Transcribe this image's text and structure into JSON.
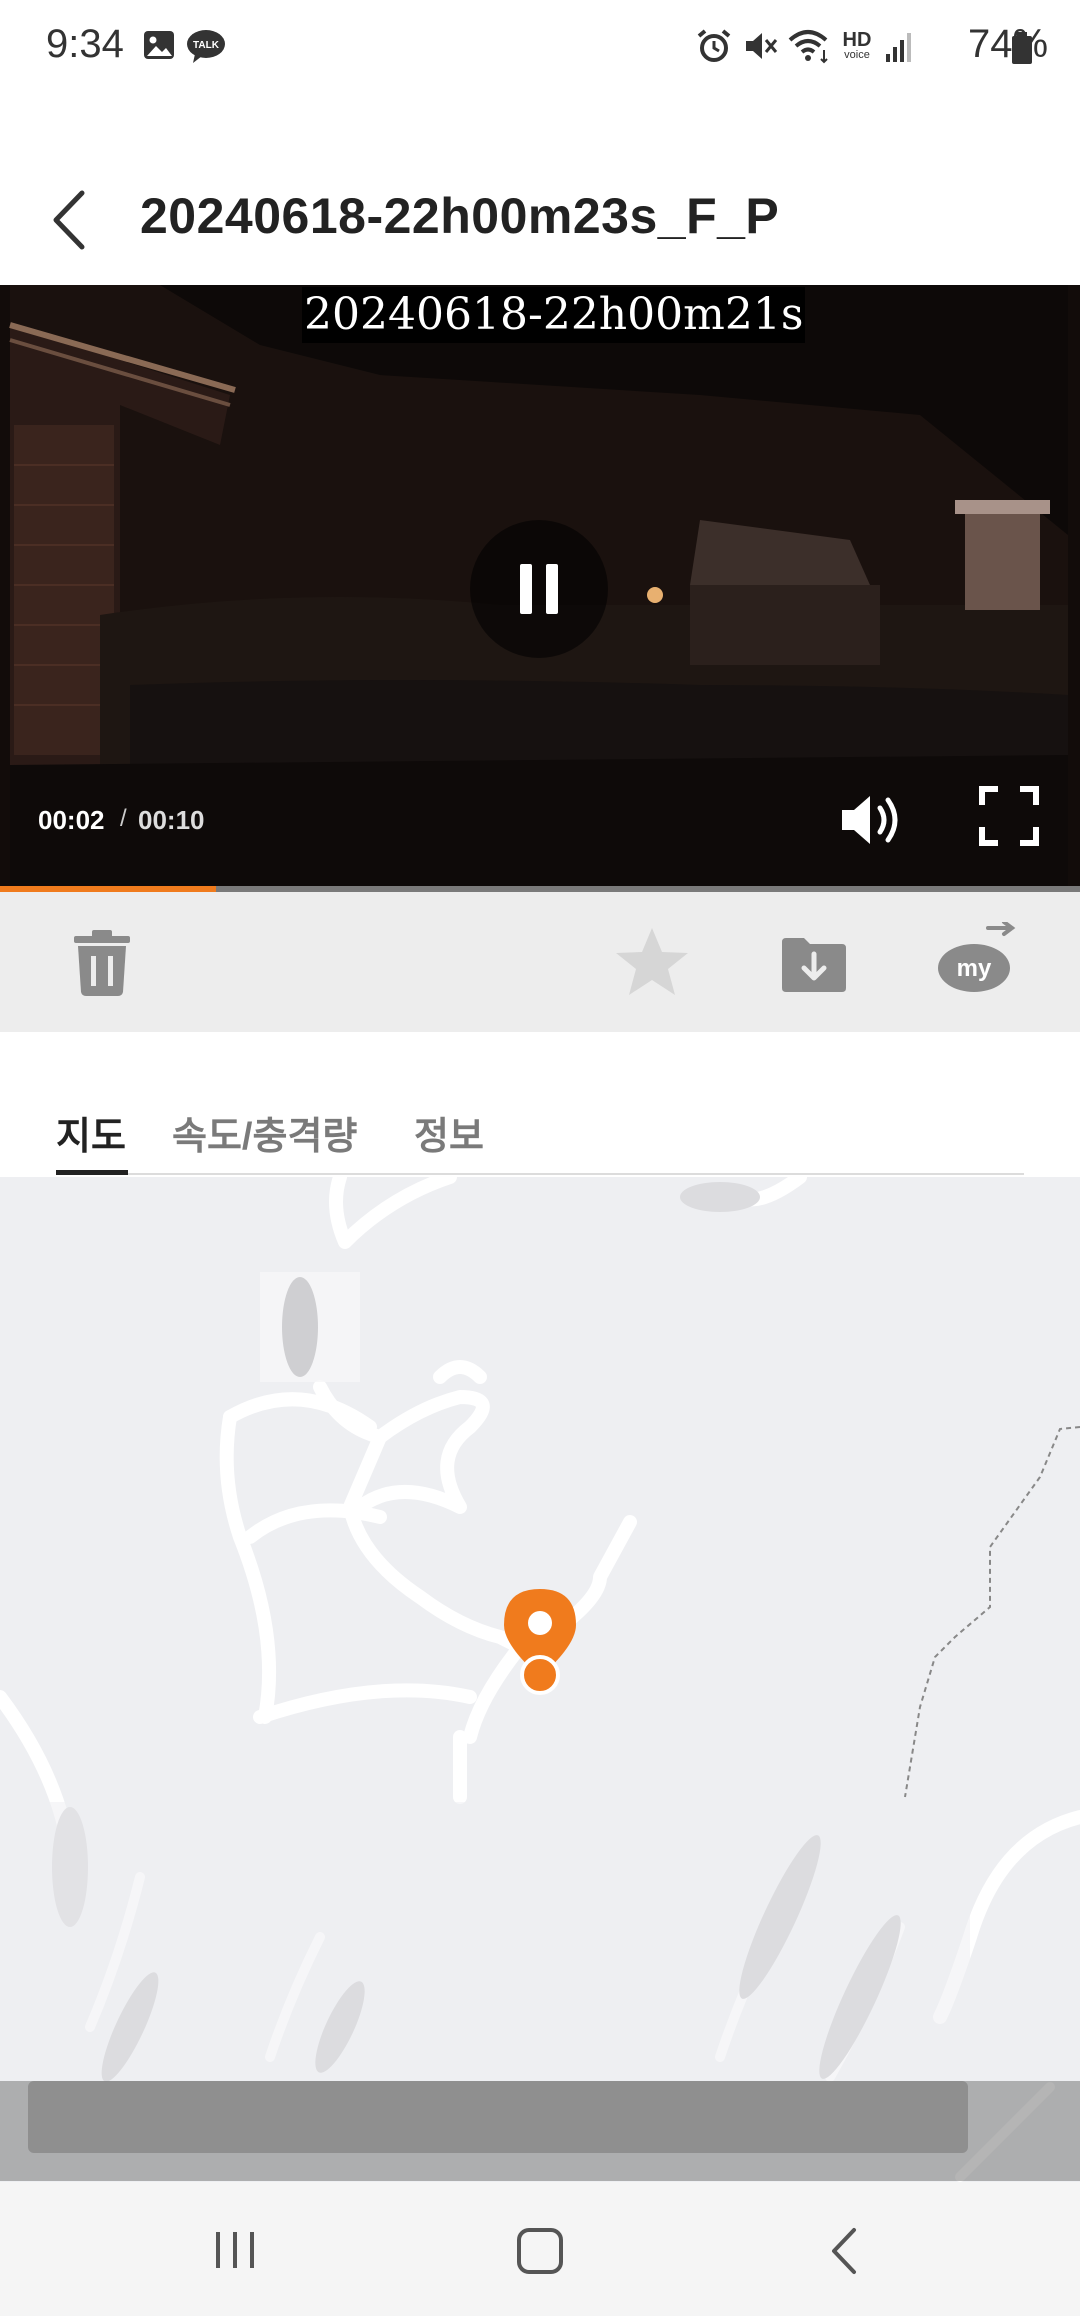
{
  "status_bar": {
    "time": "9:34",
    "battery": "74%",
    "network_badge": "HD",
    "network_badge_sub": "voice",
    "icons": [
      "gallery-icon",
      "talk-icon",
      "alarm-icon",
      "mute-icon",
      "wifi-icon",
      "hd-voice-icon",
      "signal-icon",
      "battery-icon"
    ],
    "talk_label": "TALK"
  },
  "header": {
    "title": "20240618-22h00m23s_F_P"
  },
  "video": {
    "overlay_timestamp": "20240618-22h00m21s",
    "current_time": "00:02",
    "separator": "/",
    "total_time": "00:10",
    "progress": 0.2,
    "accent_color": "#f07b1d"
  },
  "toolbar": {
    "my_label": "my",
    "icons": [
      "trash-icon",
      "star-icon",
      "download-icon",
      "share-my-icon"
    ]
  },
  "tabs": [
    {
      "label": "지도",
      "active": true
    },
    {
      "label": "속도/충격량",
      "active": false
    },
    {
      "label": "정보",
      "active": false
    }
  ],
  "map": {
    "marker_color": "#f07b1d"
  }
}
